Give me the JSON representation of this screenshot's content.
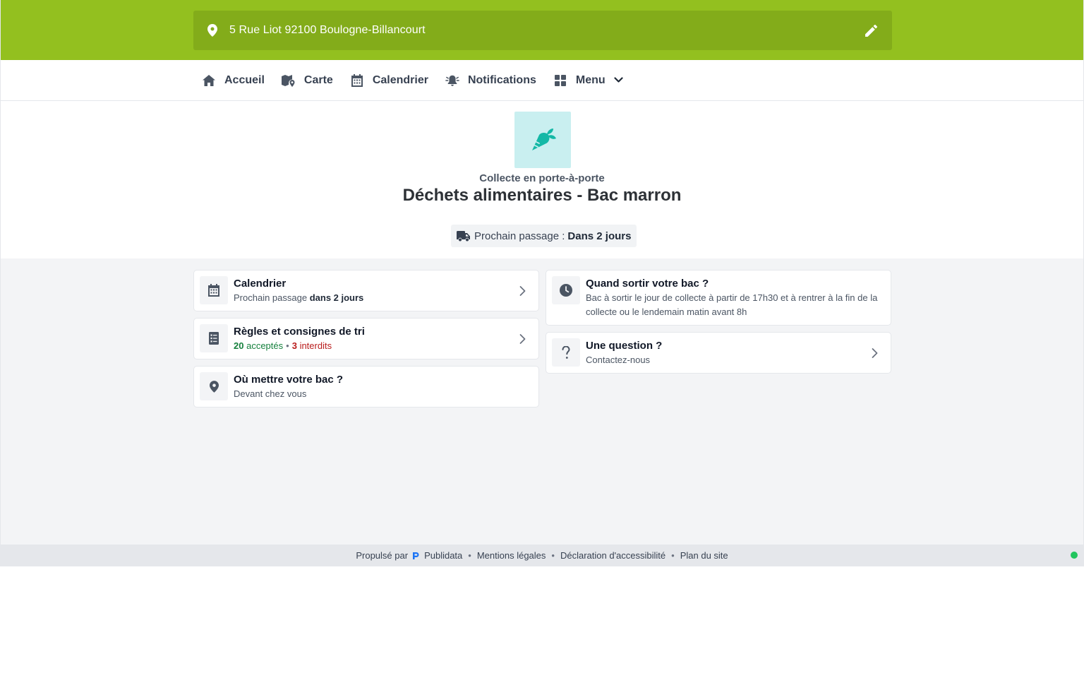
{
  "address": {
    "text": "5 Rue Liot 92100 Boulogne-Billancourt"
  },
  "nav": [
    {
      "label": "Accueil",
      "icon": "home-icon"
    },
    {
      "label": "Carte",
      "icon": "map-icon"
    },
    {
      "label": "Calendrier",
      "icon": "calendar-icon"
    },
    {
      "label": "Notifications",
      "icon": "bell-alert-icon"
    },
    {
      "label": "Menu",
      "icon": "grid-icon"
    }
  ],
  "hero": {
    "icon": "carrot-icon",
    "subtitle": "Collecte en porte-à-porte",
    "title": "Déchets alimentaires - Bac marron",
    "next_label": "Prochain passage :",
    "next_value": "Dans 2 jours"
  },
  "cards": {
    "calendar": {
      "title": "Calendrier",
      "desc_prefix": "Prochain passage",
      "desc_bold": "dans 2 jours"
    },
    "rules": {
      "title": "Règles et consignes de tri",
      "accepted_count": "20",
      "accepted_label": "acceptés",
      "forbidden_count": "3",
      "forbidden_label": "interdits"
    },
    "where": {
      "title": "Où mettre votre bac ?",
      "desc": "Devant chez vous"
    },
    "when": {
      "title": "Quand sortir votre bac ?",
      "desc": "Bac à sortir le jour de collecte à partir de 17h30 et à rentrer à la fin de la collecte ou le lendemain matin avant 8h"
    },
    "question": {
      "title": "Une question ?",
      "desc": "Contactez-nous"
    }
  },
  "footer": {
    "powered": "Propulsé par",
    "brand": "Publidata",
    "links": [
      "Mentions légales",
      "Déclaration d'accessibilité",
      "Plan du site"
    ]
  },
  "colors": {
    "brand_green": "#93c01f",
    "brand_green_dark": "#83ac1a",
    "accent_teal": "#14b8a6",
    "status_green": "#22c55e"
  }
}
